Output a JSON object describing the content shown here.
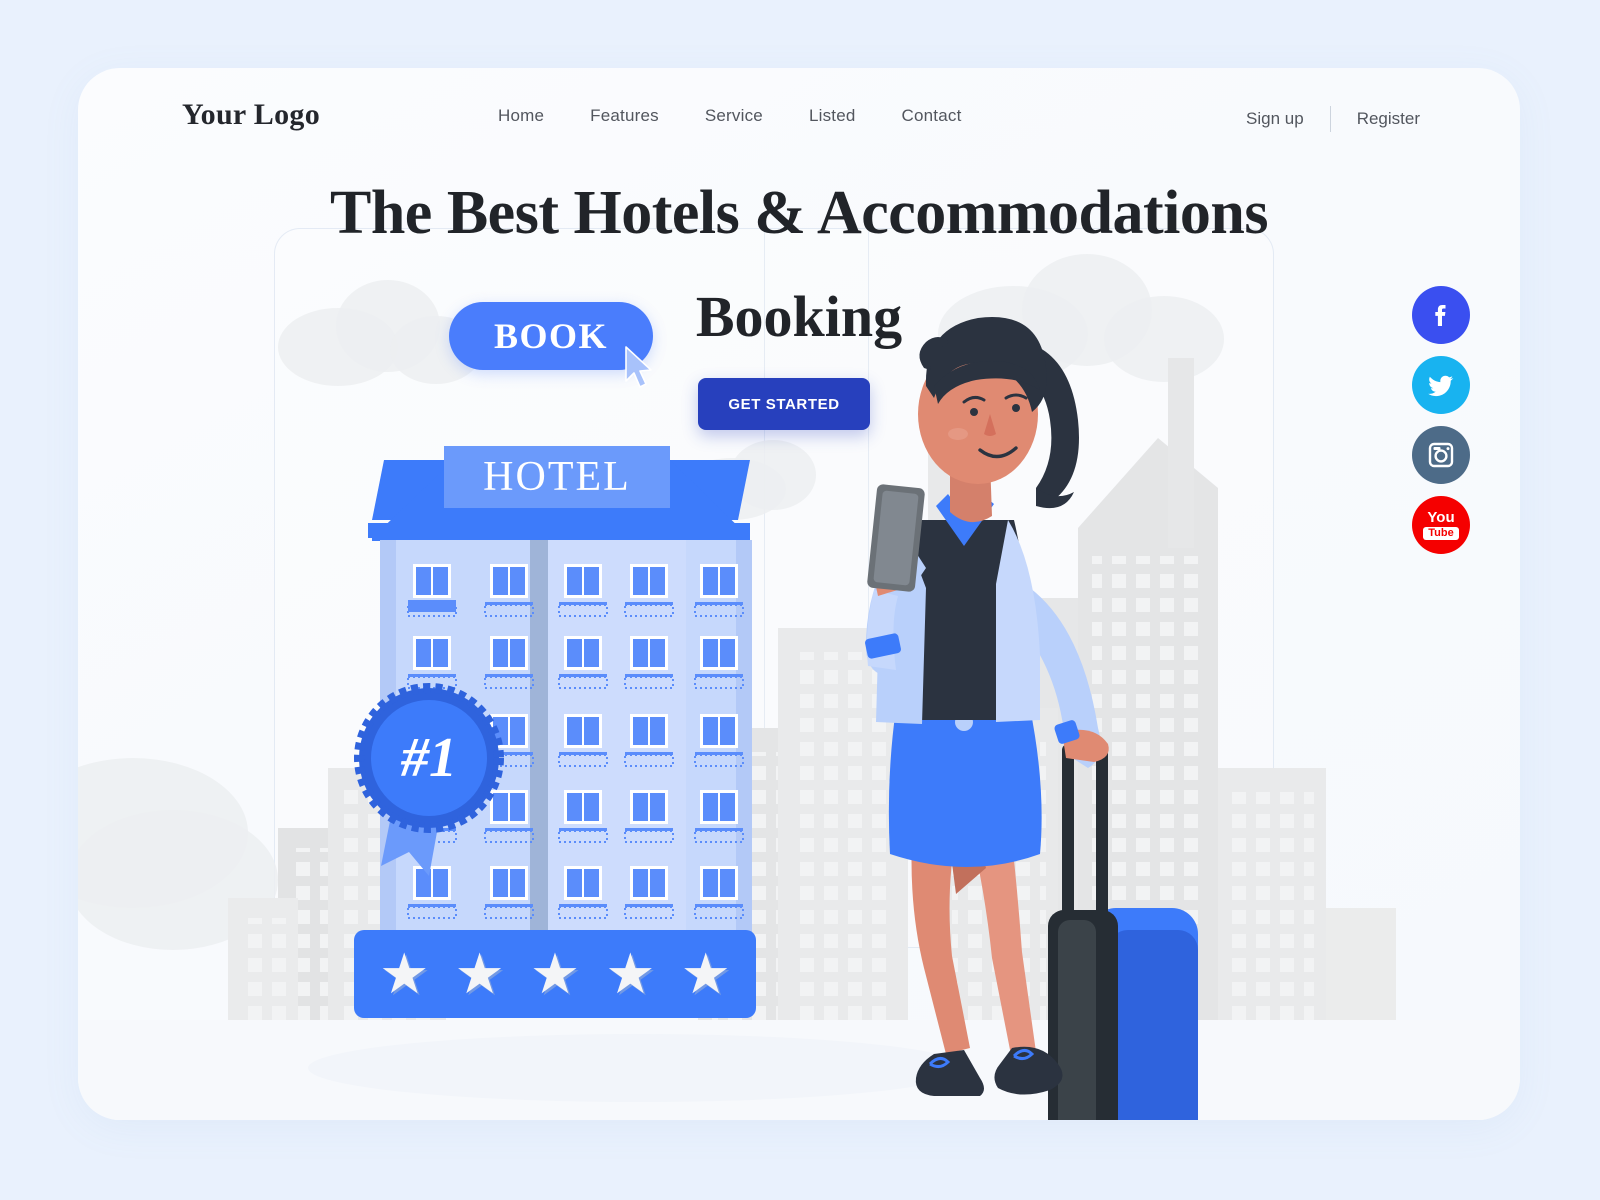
{
  "brand": {
    "logo": "Your Logo"
  },
  "nav": {
    "items": [
      {
        "label": "Home"
      },
      {
        "label": "Features"
      },
      {
        "label": "Service"
      },
      {
        "label": "Listed"
      },
      {
        "label": "Contact"
      }
    ]
  },
  "auth": {
    "signup": "Sign up",
    "register": "Register"
  },
  "hero": {
    "headline": "The Best Hotels & Accommodations",
    "subhead": "Booking",
    "book_label": "BOOK",
    "cta_label": "GET STARTED"
  },
  "illustration": {
    "hotel_sign": "HOTEL",
    "badge": "#1",
    "stars": 5,
    "star_glyph": "★"
  },
  "social": {
    "items": [
      {
        "name": "facebook",
        "label": "f",
        "color": "#3a4ff0"
      },
      {
        "name": "twitter",
        "label": "",
        "color": "#18b3f0"
      },
      {
        "name": "instagram",
        "label": "",
        "color": "#4d6b88"
      },
      {
        "name": "youtube",
        "label": "You",
        "label2": "Tube",
        "color": "#f50000"
      }
    ]
  },
  "colors": {
    "page_bg": "#e9f1fd",
    "card_bg": "#f8fafd",
    "accent_blue": "#4a7dfc",
    "deep_blue": "#2740bd",
    "building_light": "#c3d6fb",
    "building_mid": "#b6cbf8",
    "roof_blue": "#3d7bfa",
    "skyline_gray": "#e4e5e6",
    "skin": "#e08a72",
    "hair_dark": "#2b3340",
    "jacket_blue": "#b9d0fb",
    "skirt_blue": "#3d7bfa"
  }
}
